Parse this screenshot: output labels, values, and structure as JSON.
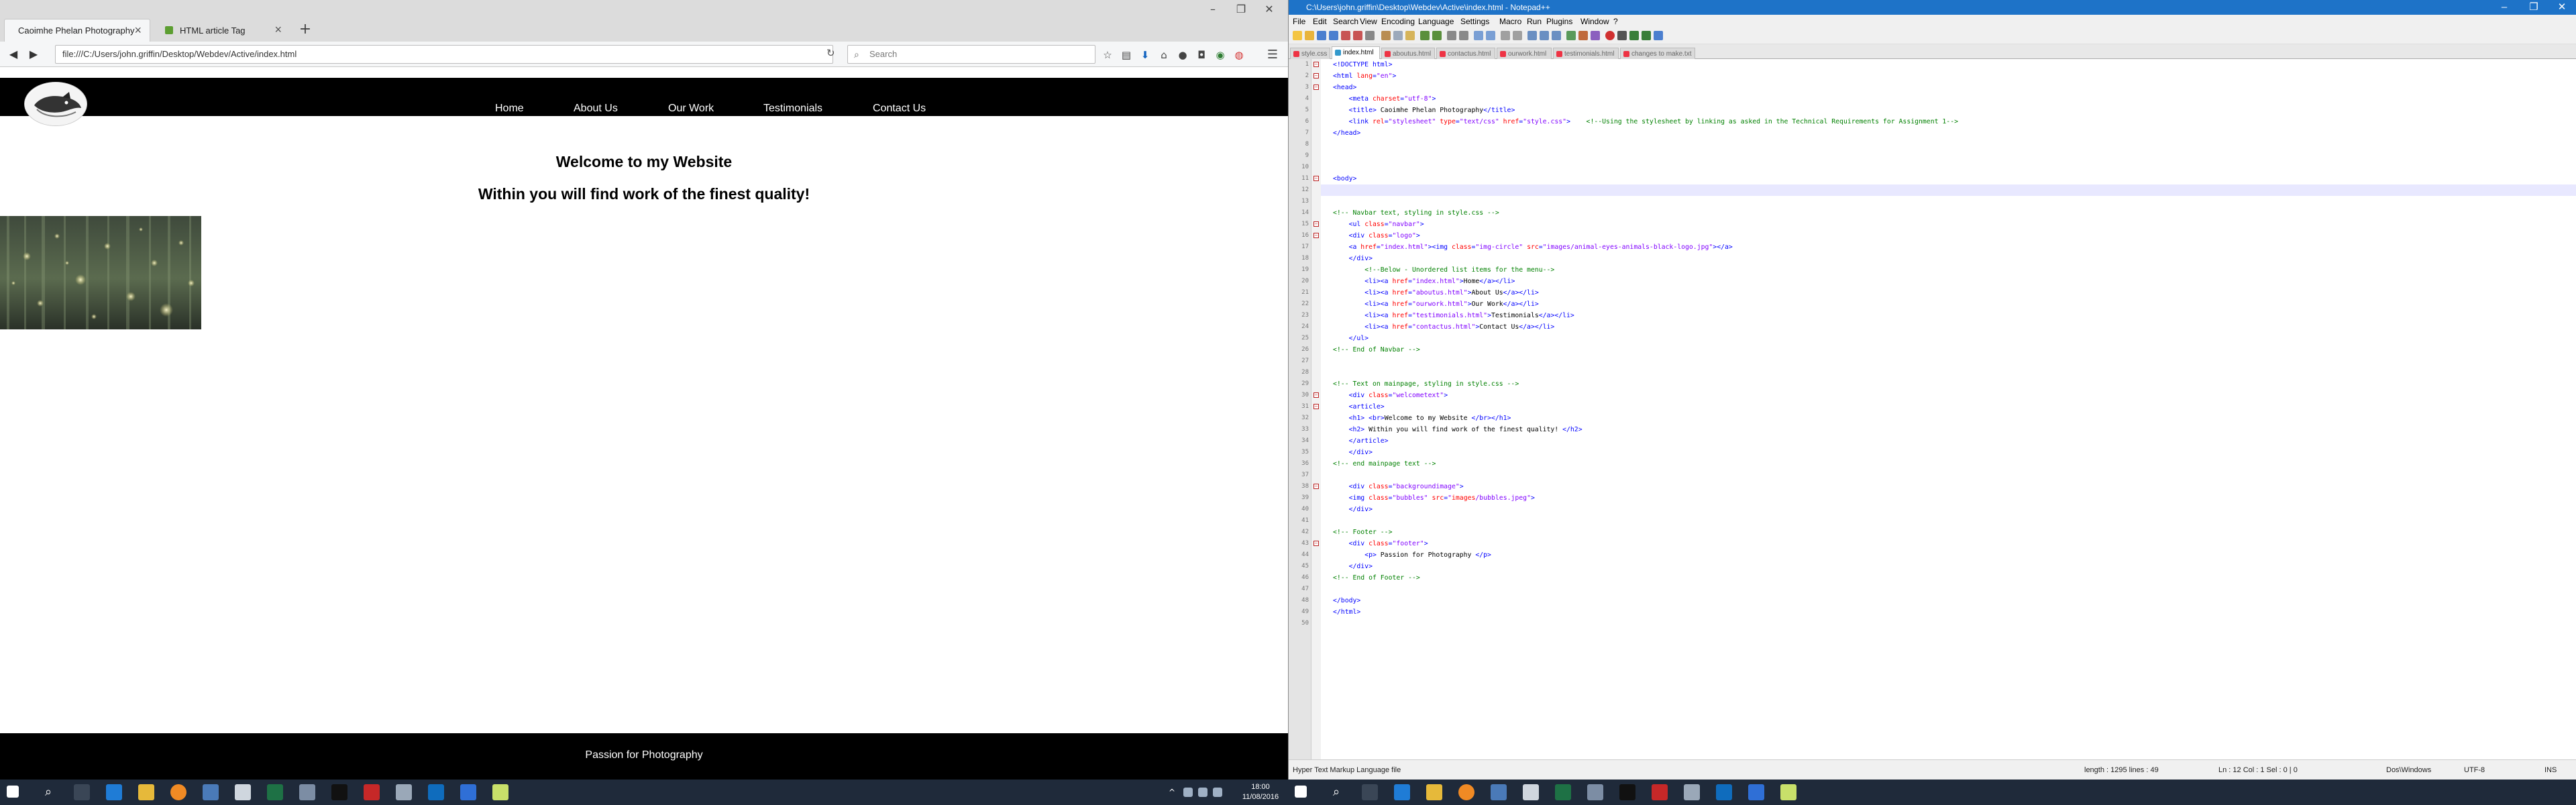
{
  "firefox": {
    "tabs": [
      {
        "label": "Caoimhe Phelan Photography",
        "active": true
      },
      {
        "label": "HTML article Tag",
        "active": false
      }
    ],
    "url": "file:///C:/Users/john.griffin/Desktop/Webdev/Active/index.html",
    "search_placeholder": "Search"
  },
  "site": {
    "nav": [
      "Home",
      "About Us",
      "Our Work",
      "Testimonials",
      "Contact Us"
    ],
    "h1": "Welcome to my Website",
    "h2": "Within you will find work of the finest quality!",
    "footer": "Passion for Photography"
  },
  "npp": {
    "title": "C:\\Users\\john.griffin\\Desktop\\Webdev\\Active\\index.html - Notepad++",
    "menu": [
      "File",
      "Edit",
      "Search",
      "View",
      "Encoding",
      "Language",
      "Settings",
      "Macro",
      "Run",
      "Plugins",
      "Window",
      "?"
    ],
    "tabs": [
      "style.css",
      "index.html",
      "aboutus.html",
      "contactus.html",
      "ourwork.html",
      "testimonials.html",
      "changes to make.txt"
    ],
    "status": {
      "filetype": "Hyper Text Markup Language file",
      "length": "length : 1295   lines : 49",
      "pos": "Ln : 12   Col : 1   Sel : 0 | 0",
      "eol": "Dos\\Windows",
      "enc": "UTF-8",
      "ins": "INS"
    }
  },
  "taskbar": {
    "time": "18:00",
    "date": "11/08/2016"
  }
}
